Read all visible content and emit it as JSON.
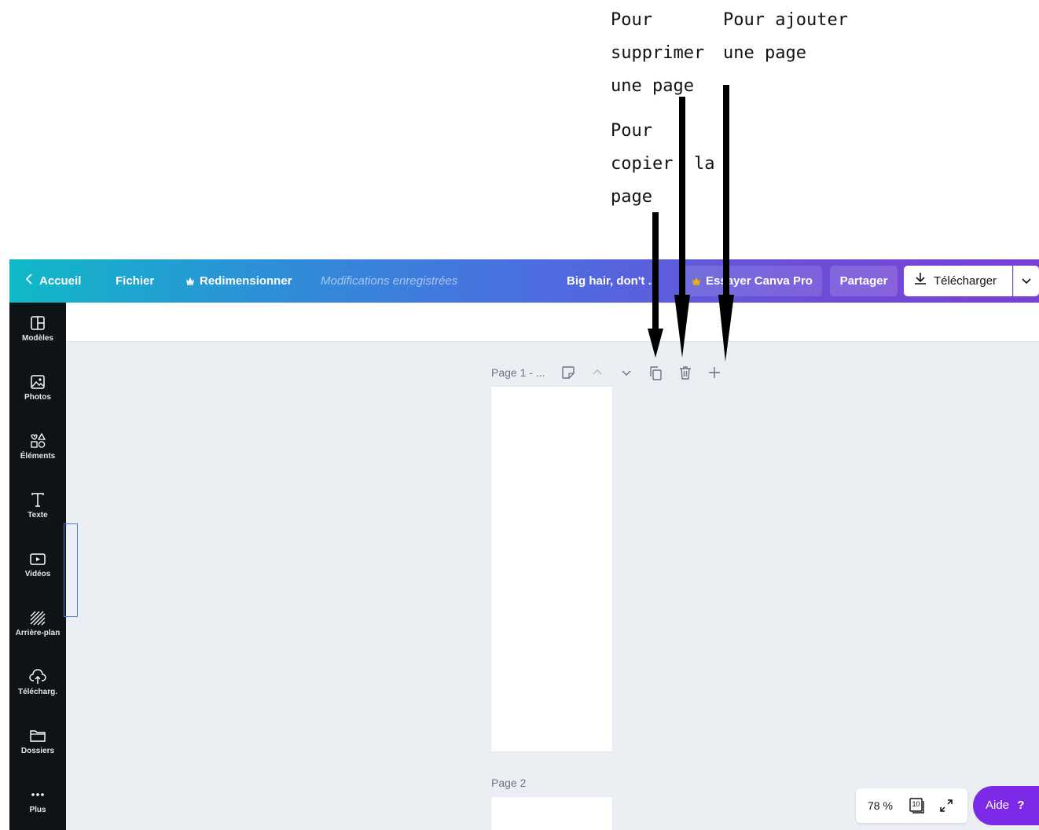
{
  "annotations": {
    "delete_page": "Pour\nsupprimer\nune page",
    "add_page": "Pour ajouter\nune page",
    "copy_page": "Pour\ncopier  la\npage"
  },
  "topbar": {
    "home_label": "Accueil",
    "file_label": "Fichier",
    "resize_label": "Redimensionner",
    "saved_status": "Modifications enregistrées",
    "design_title": "Big hair, don't ...",
    "try_pro_label": "Essayer Canva Pro",
    "share_label": "Partager",
    "download_label": "Télécharger"
  },
  "sidebar": {
    "items": [
      {
        "label": "Modèles",
        "icon": "layout-icon"
      },
      {
        "label": "Photos",
        "icon": "image-icon"
      },
      {
        "label": "Éléments",
        "icon": "shapes-icon"
      },
      {
        "label": "Texte",
        "icon": "text-icon"
      },
      {
        "label": "Vidéos",
        "icon": "video-icon"
      },
      {
        "label": "Arrière-plan",
        "icon": "background-icon"
      },
      {
        "label": "Télécharg.",
        "icon": "upload-icon"
      },
      {
        "label": "Dossiers",
        "icon": "folder-icon"
      },
      {
        "label": "Plus",
        "icon": "more-icon"
      }
    ]
  },
  "pages": [
    {
      "title": "Page 1 - ..."
    },
    {
      "title": "Page 2"
    }
  ],
  "footer": {
    "zoom": "78 %",
    "page_count": "10",
    "help_label": "Aide",
    "help_mark": "?"
  },
  "colors": {
    "accent": "#7d2ae8",
    "sidebar_bg": "#0e1318",
    "canvas_bg": "#ebeef2"
  }
}
